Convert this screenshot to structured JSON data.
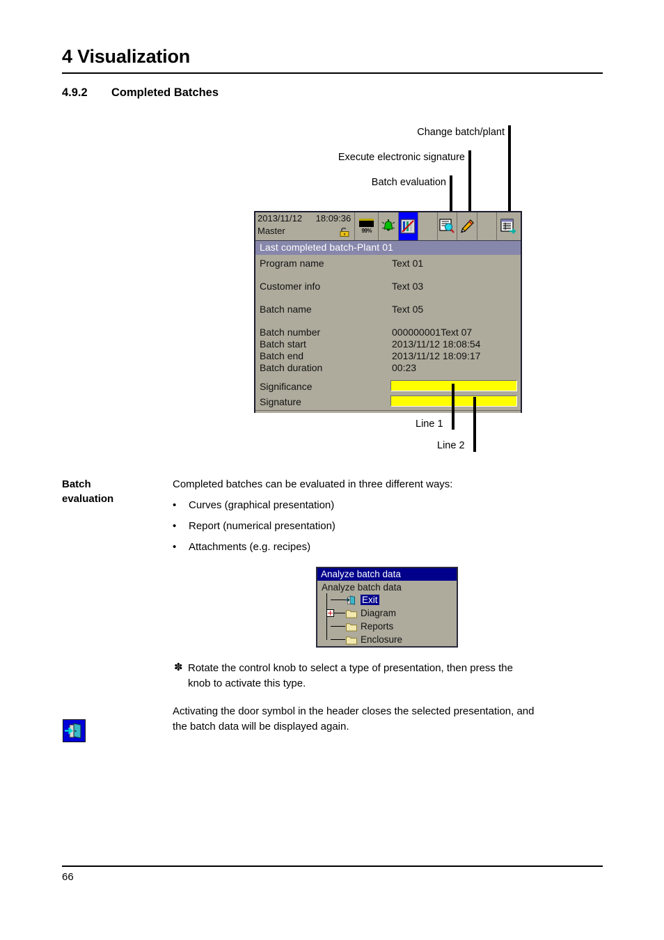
{
  "document": {
    "chapter_title": "4 Visualization",
    "section_number": "4.9.2",
    "section_title": "Completed Batches",
    "page_number": "66"
  },
  "callouts": {
    "top": [
      {
        "label": "Change batch/plant"
      },
      {
        "label": "Execute electronic signature"
      },
      {
        "label": "Batch evaluation"
      }
    ],
    "bottom": [
      {
        "label": "Line 1"
      },
      {
        "label": "Line 2"
      }
    ]
  },
  "device_screen": {
    "header": {
      "date": "2013/11/12",
      "time": "18:09:36",
      "user": "Master",
      "lock_icon": "open-padlock-icon",
      "battery_percent": "99%",
      "toolbar_icons": [
        "battery-icon",
        "alarm-bell-icon",
        "process-screen-icon",
        "blank",
        "batch-evaluation-icon",
        "electronic-signature-icon",
        "blank",
        "change-batch-plant-icon"
      ]
    },
    "title": "Last completed batch-Plant 01",
    "fields": [
      {
        "label": "Program name",
        "value": "Text 01"
      },
      {
        "label": "Customer info",
        "value": "Text 03"
      },
      {
        "label": "Batch name",
        "value": "Text 05"
      },
      {
        "label": "Batch number",
        "value": "000000001Text 07"
      },
      {
        "label": "Batch start",
        "value": "2013/11/12 18:08:54"
      },
      {
        "label": "Batch end",
        "value": "2013/11/12 18:09:17"
      },
      {
        "label": "Batch duration",
        "value": "00:23"
      }
    ],
    "input_fields": [
      {
        "label": "Significance",
        "value": ""
      },
      {
        "label": "Signature",
        "value": ""
      }
    ],
    "colors": {
      "screen_bg": "#aeaa9c",
      "title_bar": "#8786ab",
      "selected_tool": "#0000ff",
      "input_field": "#ffff00"
    }
  },
  "batch_evaluation": {
    "side_label_line1": "Batch",
    "side_label_line2": "evaluation",
    "intro": "Completed batches can be evaluated in three different ways:",
    "bullets": [
      "Curves (graphical presentation)",
      "Report (numerical presentation)",
      "Attachments (e.g. recipes)"
    ],
    "note_marker": "✽",
    "note_line1": "Rotate the control knob to select a type of presentation, then press the",
    "note_line2": "knob to activate this type.",
    "paragraph_line1": "Activating the door symbol in the header closes the selected presentation, and",
    "paragraph_line2": "the batch data will be displayed again.",
    "margin_icon": "exit-door-icon"
  },
  "analyze_dialog": {
    "title": "Analyze batch data",
    "root": "Analyze batch data",
    "items": [
      {
        "label": "Exit",
        "icon": "exit-door-icon",
        "selected": true,
        "expandable": false
      },
      {
        "label": "Diagram",
        "icon": "folder-icon",
        "selected": false,
        "expandable": true
      },
      {
        "label": "Reports",
        "icon": "folder-icon",
        "selected": false,
        "expandable": false
      },
      {
        "label": "Enclosure",
        "icon": "folder-icon",
        "selected": false,
        "expandable": false
      }
    ],
    "colors": {
      "title_bar": "#00008b",
      "dialog_bg": "#aeaa9c",
      "selection": "#00008b"
    }
  }
}
